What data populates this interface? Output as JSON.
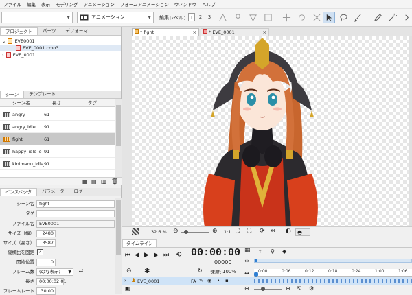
{
  "menu": [
    "ファイル",
    "編集",
    "表示",
    "モデリング",
    "アニメーション",
    "フォームアニメーション",
    "ウィンドウ",
    "ヘルプ"
  ],
  "toolbar": {
    "mode": "アニメーション",
    "edit_level_label": "編集レベル：",
    "levels": [
      "1",
      "2",
      "3"
    ]
  },
  "project": {
    "tabs": [
      "プロジェクト",
      "パーツ",
      "デフォーマ"
    ],
    "items": [
      {
        "label": "EVE0001",
        "indent": 0
      },
      {
        "label": "EVE_0001.cmo3",
        "indent": 1
      },
      {
        "label": "EVE_0001",
        "indent": 0
      }
    ]
  },
  "scene": {
    "tabs": [
      "シーン",
      "テンプレート"
    ],
    "headers": [
      "シーン名",
      "長さ",
      "タグ"
    ],
    "rows": [
      {
        "name": "angry",
        "len": "61"
      },
      {
        "name": "angry_idle",
        "len": "91"
      },
      {
        "name": "fight",
        "len": "61"
      },
      {
        "name": "happy_idle_e",
        "len": "91"
      },
      {
        "name": "kinimanu_idle_e",
        "len": "91"
      }
    ]
  },
  "inspector": {
    "tabs": [
      "インスペクタ",
      "パラメータ",
      "ログ"
    ],
    "fields": [
      {
        "label": "シーン名",
        "value": "fight"
      },
      {
        "label": "タグ",
        "value": ""
      },
      {
        "label": "ファイル名",
        "value": "EVE0001"
      },
      {
        "label": "サイズ（幅）",
        "value": "2480"
      },
      {
        "label": "サイズ（高さ）",
        "value": "3587"
      },
      {
        "label": "縦横比を固定",
        "value": ""
      },
      {
        "label": "開始位置",
        "value": "0"
      },
      {
        "label": "フレーム数",
        "value": "(のな表示)"
      },
      {
        "label": "長さ",
        "value": "00:00:02:01"
      },
      {
        "label": "フレームレート",
        "value": "30.00"
      }
    ]
  },
  "viewer": {
    "tabs": [
      "* fight",
      "* EVE_0001"
    ],
    "zoom": "32.6 %",
    "ratio": "1:1"
  },
  "timeline": {
    "tab": "タイムライン",
    "timecode": "00:00:00",
    "frame": "00000",
    "speed_label": "速度:",
    "speed": "100%",
    "track_name": "EVE_0001",
    "track_flag": "FA",
    "ticks": [
      "0:00",
      "0:06",
      "0:12",
      "0:18",
      "0:24",
      "1:00",
      "1:06"
    ]
  },
  "colors": {
    "accent": "#4a90d9",
    "selected_row": "#c8c8c8"
  }
}
